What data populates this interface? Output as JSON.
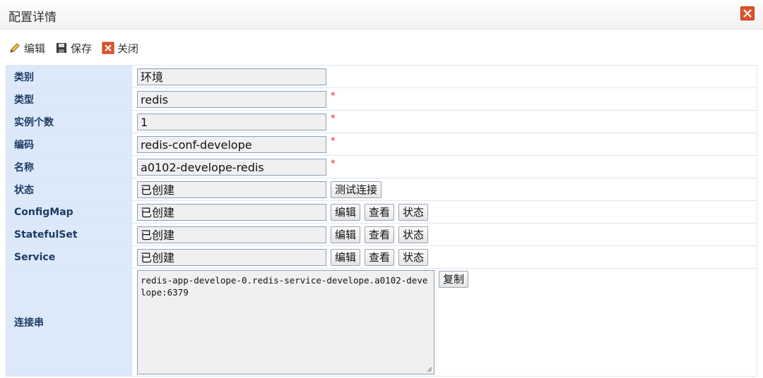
{
  "dialog": {
    "title": "配置详情",
    "close_icon": "close-icon"
  },
  "toolbar": {
    "edit_label": "编辑",
    "save_label": "保存",
    "close_label": "关闭"
  },
  "fields": {
    "category": {
      "label": "类别",
      "value": "环境"
    },
    "type": {
      "label": "类型",
      "value": "redis",
      "required": "*"
    },
    "instances": {
      "label": "实例个数",
      "value": "1",
      "required": "*"
    },
    "code": {
      "label": "编码",
      "value": "redis-conf-develope",
      "required": "*"
    },
    "name": {
      "label": "名称",
      "value": "a0102-develope-redis",
      "required": "*"
    },
    "status": {
      "label": "状态",
      "value": "已创建",
      "test_button": "测试连接"
    },
    "configmap": {
      "label": "ConfigMap",
      "value": "已创建",
      "edit": "编辑",
      "view": "查看",
      "state": "状态"
    },
    "statefulset": {
      "label": "StatefulSet",
      "value": "已创建",
      "edit": "编辑",
      "view": "查看",
      "state": "状态"
    },
    "service": {
      "label": "Service",
      "value": "已创建",
      "edit": "编辑",
      "view": "查看",
      "state": "状态"
    },
    "connection": {
      "label": "连接串",
      "value": "redis-app-develope-0.redis-service-develope.a0102-develope:6379",
      "copy_button": "复制"
    }
  },
  "colors": {
    "label_bg": "#dbe9fa",
    "label_text": "#1e3b63",
    "required": "#e02020",
    "close_bg": "#e0522d"
  }
}
